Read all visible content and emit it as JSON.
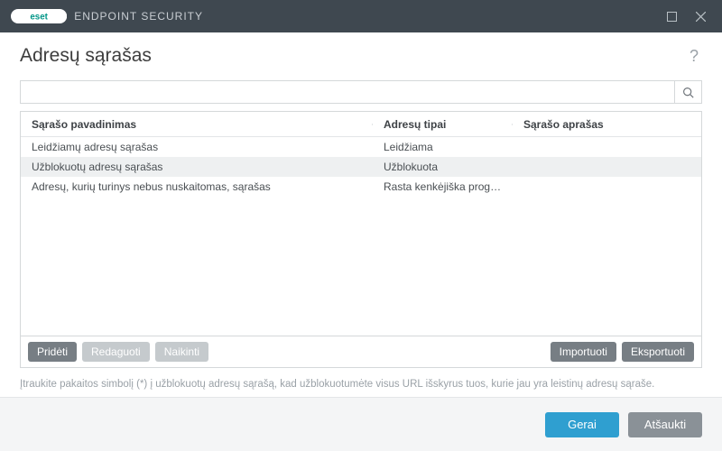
{
  "titlebar": {
    "product": "ENDPOINT SECURITY"
  },
  "page": {
    "title": "Adresų sąrašas"
  },
  "search": {
    "value": "",
    "placeholder": ""
  },
  "table": {
    "headers": {
      "name": "Sąrašo pavadinimas",
      "type": "Adresų tipai",
      "desc": "Sąrašo aprašas"
    },
    "rows": [
      {
        "name": "Leidžiamų adresų sąrašas",
        "type": "Leidžiama",
        "desc": "",
        "selected": false
      },
      {
        "name": "Užblokuotų adresų sąrašas",
        "type": "Užblokuota",
        "desc": "",
        "selected": true
      },
      {
        "name": "Adresų, kurių turinys nebus nuskaitomas, sąrašas",
        "type": "Rasta kenkėjiška program...",
        "desc": "",
        "selected": false
      }
    ]
  },
  "buttons": {
    "add": "Pridėti",
    "edit": "Redaguoti",
    "delete": "Naikinti",
    "import": "Importuoti",
    "export": "Eksportuoti"
  },
  "hint": "Įtraukite pakaitos simbolį (*) į užblokuotų adresų sąrašą, kad užblokuotumėte visus URL išskyrus tuos, kurie jau yra leistinų adresų sąraše.",
  "footer": {
    "ok": "Gerai",
    "cancel": "Atšaukti"
  }
}
